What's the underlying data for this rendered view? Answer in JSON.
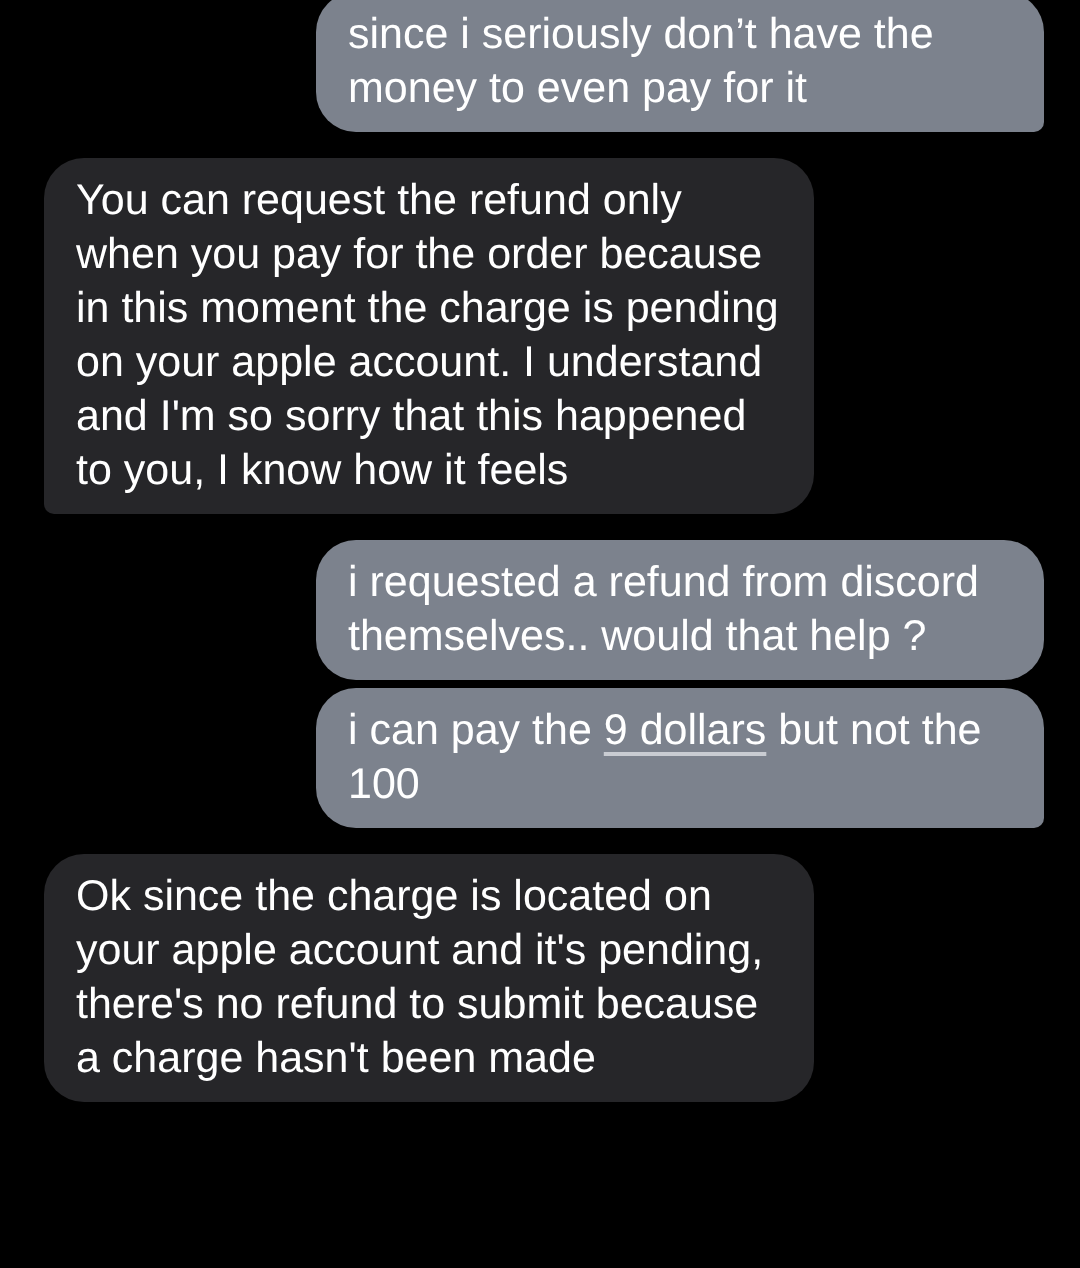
{
  "messages": [
    {
      "kind": "sent",
      "tail": true,
      "parts": [
        {
          "text": "since i seriously don’t have the money to even pay for it",
          "kind": "text"
        }
      ]
    },
    {
      "kind": "received",
      "tail": true,
      "parts": [
        {
          "text": "You can request the refund only when you pay for the order because in this moment the charge is pending on your apple account. I understand and I'm so sorry that this happened to you, I know how it feels",
          "kind": "text"
        }
      ]
    },
    {
      "kind": "sent",
      "tail": false,
      "parts": [
        {
          "text": "i requested a refund from discord themselves.. would that help ?",
          "kind": "text"
        }
      ]
    },
    {
      "kind": "sent",
      "tail": true,
      "parts": [
        {
          "text": "i can pay the ",
          "kind": "text"
        },
        {
          "text": "9 dollars",
          "kind": "link"
        },
        {
          "text": " but not the 100",
          "kind": "text"
        }
      ]
    },
    {
      "kind": "received",
      "tail": false,
      "parts": [
        {
          "text": "Ok since the charge is located on your apple account and it's pending, there's no refund to submit because a charge hasn't been made",
          "kind": "text"
        }
      ]
    }
  ]
}
